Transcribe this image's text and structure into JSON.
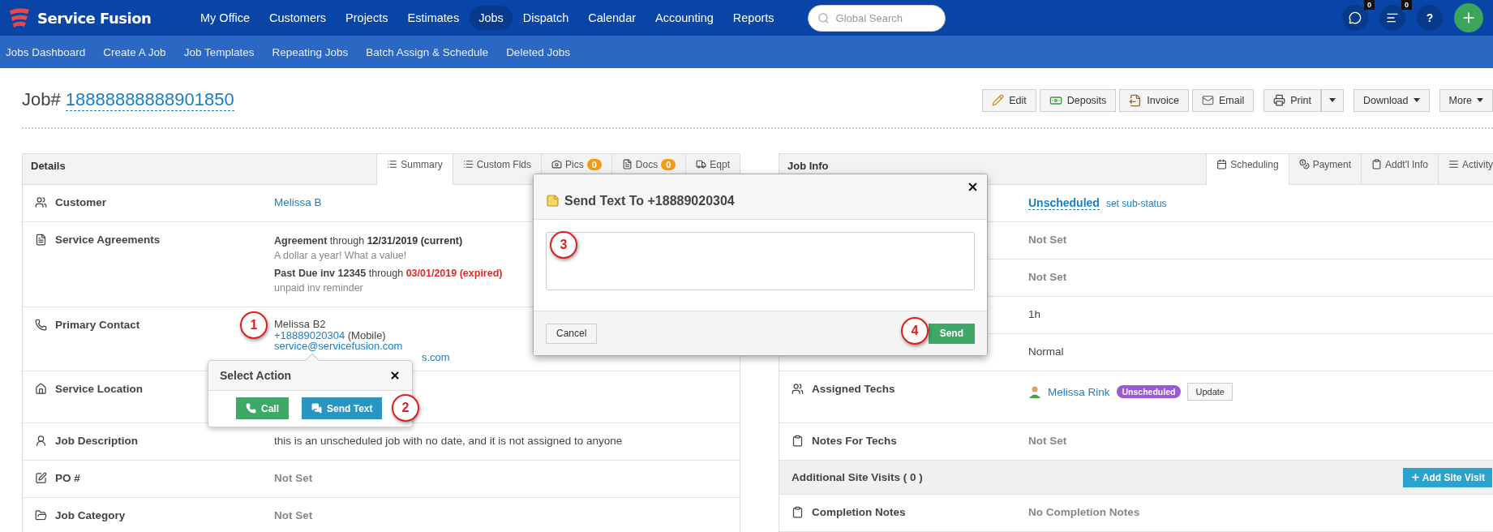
{
  "brand": {
    "name": "Service Fusion"
  },
  "nav": [
    {
      "label": "My Office",
      "selected": false
    },
    {
      "label": "Customers",
      "selected": false
    },
    {
      "label": "Projects",
      "selected": false
    },
    {
      "label": "Estimates",
      "selected": false
    },
    {
      "label": "Jobs",
      "selected": true
    },
    {
      "label": "Dispatch",
      "selected": false
    },
    {
      "label": "Calendar",
      "selected": false
    },
    {
      "label": "Accounting",
      "selected": false
    },
    {
      "label": "Reports",
      "selected": false
    }
  ],
  "search": {
    "placeholder": "Global Search"
  },
  "header_buttons": [
    {
      "kind": "chat",
      "badge": "0"
    },
    {
      "kind": "notes",
      "badge": "0"
    },
    {
      "kind": "help",
      "label": "?"
    },
    {
      "kind": "add"
    }
  ],
  "subnav": [
    "Jobs Dashboard",
    "Create A Job",
    "Job Templates",
    "Repeating Jobs",
    "Batch Assign & Schedule",
    "Deleted Jobs"
  ],
  "job": {
    "label": "Job#",
    "number": "18888888888901850"
  },
  "actions": [
    {
      "kind": "edit",
      "label": "Edit"
    },
    {
      "kind": "deposits",
      "label": "Deposits"
    },
    {
      "kind": "invoice",
      "label": "Invoice"
    },
    {
      "kind": "email",
      "label": "Email"
    },
    {
      "kind": "print",
      "label": "Print",
      "split": true
    },
    {
      "kind": "download",
      "label": "Download",
      "menu": true
    },
    {
      "kind": "more",
      "label": "More",
      "menu": true
    }
  ],
  "details": {
    "title": "Details",
    "tabs": [
      {
        "kind": "summary",
        "label": "Summary",
        "selected": true
      },
      {
        "kind": "custom",
        "label": "Custom Flds",
        "selected": false
      },
      {
        "kind": "pics",
        "label": "Pics",
        "badge": "0",
        "selected": false
      },
      {
        "kind": "docs",
        "label": "Docs",
        "badge": "0",
        "selected": false
      },
      {
        "kind": "equipment",
        "label": "Eqpt",
        "selected": false
      }
    ],
    "rows": [
      {
        "kind": "link",
        "label": "Customer",
        "value": "Melissa B"
      },
      {
        "kind": "agreements",
        "label": "Service Agreements",
        "agreements": [
          {
            "name": "Agreement",
            "through": "through",
            "date": "12/31/2019 (current)",
            "expired": false,
            "note": "A dollar a year! What a value!"
          },
          {
            "name": "Past Due inv 12345",
            "through": "through",
            "date": "03/01/2019 (expired)",
            "expired": true,
            "note": "unpaid inv reminder"
          }
        ]
      },
      {
        "kind": "contact",
        "label": "Primary Contact",
        "name": "Melissa B2",
        "phone": "+18889020304",
        "phone_type": "(Mobile)",
        "emails": [
          "service@servicefusion.com",
          "s.com"
        ]
      },
      {
        "kind": "empty",
        "label": "Service Location"
      },
      {
        "kind": "text",
        "label": "Job Description",
        "value": "this is an unscheduled job with no date, and it is not assigned to anyone"
      },
      {
        "kind": "notset",
        "label": "PO #",
        "value": "Not Set"
      },
      {
        "kind": "notset",
        "label": "Job Category",
        "value": "Not Set"
      }
    ]
  },
  "job_info": {
    "title": "Job Info",
    "tabs": [
      {
        "kind": "scheduling",
        "label": "Scheduling",
        "selected": true
      },
      {
        "kind": "payment",
        "label": "Payment",
        "selected": false
      },
      {
        "kind": "info",
        "label": "Addt'l Info",
        "selected": false
      },
      {
        "kind": "activity",
        "label": "Activity",
        "selected": false
      }
    ],
    "rows": [
      {
        "kind": "status",
        "value": "Unscheduled",
        "link": "set sub-status"
      },
      {
        "kind": "notset",
        "value": "Not Set"
      },
      {
        "kind": "notset",
        "value": "Not Set"
      },
      {
        "kind": "text",
        "value": "1h"
      },
      {
        "kind": "text",
        "value": "Normal"
      },
      {
        "kind": "techs",
        "label": "Assigned Techs",
        "tech": "Melissa Rink",
        "badge": "Unscheduled",
        "button": "Update"
      },
      {
        "kind": "notset",
        "label": "Notes For Techs",
        "value": "Not Set"
      },
      {
        "kind": "band",
        "label": "Additional Site Visits ( 0 )",
        "button": "Add Site Visit"
      },
      {
        "kind": "notset",
        "label": "Completion Notes",
        "value": "No Completion Notes"
      }
    ]
  },
  "select_action": {
    "title": "Select Action",
    "buttons": [
      {
        "kind": "call",
        "label": "Call"
      },
      {
        "kind": "text",
        "label": "Send Text"
      }
    ]
  },
  "send_text": {
    "title": "Send Text To +18889020304",
    "cancel": "Cancel",
    "send": "Send"
  },
  "annotations": [
    "1",
    "2",
    "3",
    "4"
  ]
}
